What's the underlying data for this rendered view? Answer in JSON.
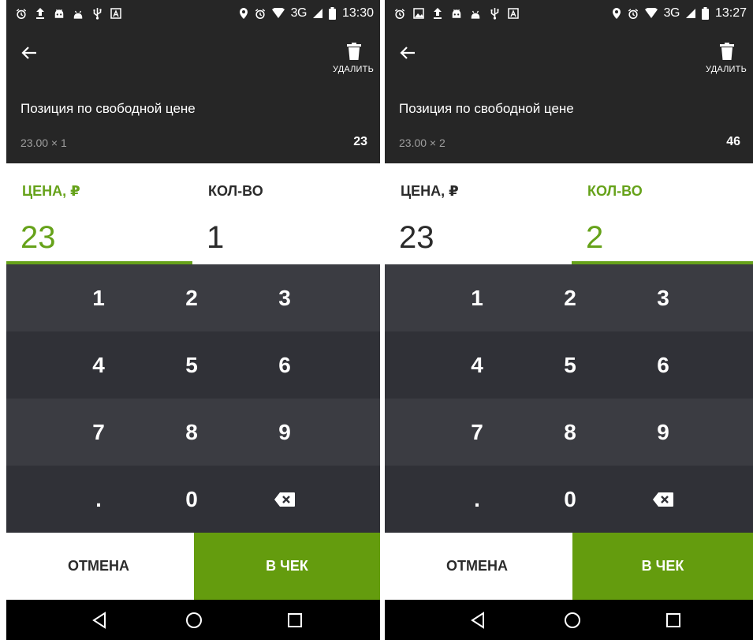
{
  "colors": {
    "accent": "#66a21a",
    "check_button": "#649c0e",
    "dark": "#262626",
    "keypad": "#3b3c42"
  },
  "screens": [
    {
      "status": {
        "network": "3G",
        "time": "13:30"
      },
      "appbar": {
        "delete_label": "УДАЛИТЬ",
        "item_title": "Позиция по свободной цене",
        "calc": "23.00 × 1",
        "total": "23"
      },
      "fields": {
        "price_label": "ЦЕНА, ₽",
        "price_value": "23",
        "qty_label": "КОЛ-ВО",
        "qty_value": "1",
        "active": "price"
      },
      "keypad": {
        "rows": [
          [
            "1",
            "2",
            "3"
          ],
          [
            "4",
            "5",
            "6"
          ],
          [
            "7",
            "8",
            "9"
          ],
          [
            ".",
            "0",
            "backspace-icon"
          ]
        ]
      },
      "buttons": {
        "cancel": "ОТМЕНА",
        "check": "В ЧЕК"
      }
    },
    {
      "status": {
        "network": "3G",
        "time": "13:27"
      },
      "appbar": {
        "delete_label": "УДАЛИТЬ",
        "item_title": "Позиция по свободной цене",
        "calc": "23.00 × 2",
        "total": "46"
      },
      "fields": {
        "price_label": "ЦЕНА, ₽",
        "price_value": "23",
        "qty_label": "КОЛ-ВО",
        "qty_value": "2",
        "active": "qty"
      },
      "keypad": {
        "rows": [
          [
            "1",
            "2",
            "3"
          ],
          [
            "4",
            "5",
            "6"
          ],
          [
            "7",
            "8",
            "9"
          ],
          [
            ".",
            "0",
            "backspace-icon"
          ]
        ]
      },
      "buttons": {
        "cancel": "ОТМЕНА",
        "check": "В ЧЕК"
      }
    }
  ]
}
